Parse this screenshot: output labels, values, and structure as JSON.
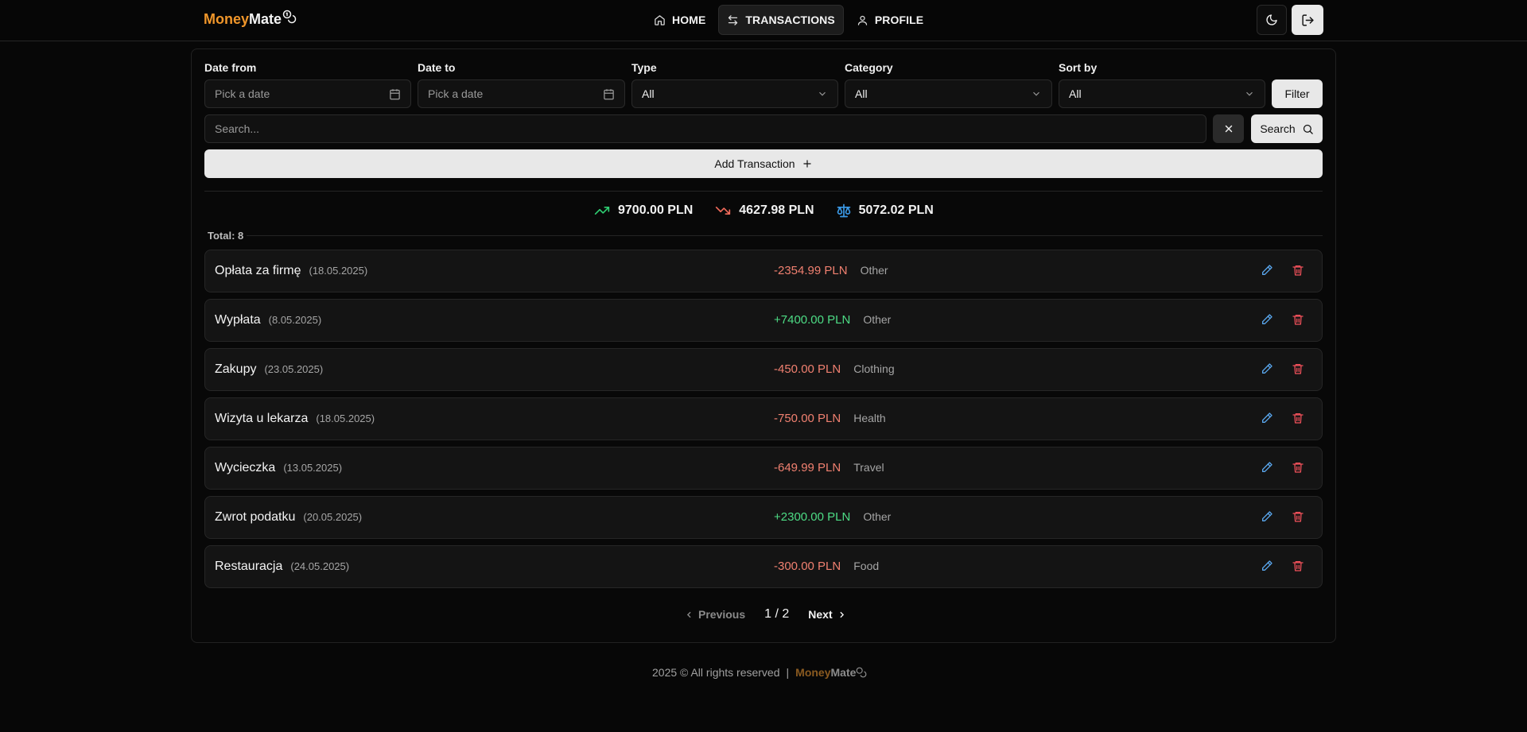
{
  "brand": {
    "part1": "Money",
    "part2": "Mate"
  },
  "nav": {
    "home": "HOME",
    "transactions": "TRANSACTIONS",
    "profile": "PROFILE"
  },
  "filters": {
    "date_from_label": "Date from",
    "date_from_placeholder": "Pick a date",
    "date_to_label": "Date to",
    "date_to_placeholder": "Pick a date",
    "type_label": "Type",
    "type_value": "All",
    "category_label": "Category",
    "category_value": "All",
    "sort_label": "Sort by",
    "sort_value": "All",
    "filter_button": "Filter"
  },
  "search": {
    "placeholder": "Search...",
    "button": "Search"
  },
  "add_button": "Add Transaction",
  "stats": {
    "income": "9700.00 PLN",
    "expense": "4627.98 PLN",
    "balance": "5072.02 PLN",
    "income_color": "#2ecc71",
    "expense_color": "#f06a5a",
    "balance_color": "#3b9ae8"
  },
  "total": "Total: 8",
  "transactions": [
    {
      "name": "Opłata za firmę",
      "date": "(18.05.2025)",
      "amount": "-2354.99 PLN",
      "sign": "neg",
      "category": "Other"
    },
    {
      "name": "Wypłata",
      "date": "(8.05.2025)",
      "amount": "+7400.00 PLN",
      "sign": "pos",
      "category": "Other"
    },
    {
      "name": "Zakupy",
      "date": "(23.05.2025)",
      "amount": "-450.00 PLN",
      "sign": "neg",
      "category": "Clothing"
    },
    {
      "name": "Wizyta u lekarza",
      "date": "(18.05.2025)",
      "amount": "-750.00 PLN",
      "sign": "neg",
      "category": "Health"
    },
    {
      "name": "Wycieczka",
      "date": "(13.05.2025)",
      "amount": "-649.99 PLN",
      "sign": "neg",
      "category": "Travel"
    },
    {
      "name": "Zwrot podatku",
      "date": "(20.05.2025)",
      "amount": "+2300.00 PLN",
      "sign": "pos",
      "category": "Other"
    },
    {
      "name": "Restauracja",
      "date": "(24.05.2025)",
      "amount": "-300.00 PLN",
      "sign": "neg",
      "category": "Food"
    }
  ],
  "pagination": {
    "previous": "Previous",
    "page": "1 / 2",
    "next": "Next"
  },
  "footer": {
    "text": "2025 © All rights reserved",
    "separator": "|"
  }
}
